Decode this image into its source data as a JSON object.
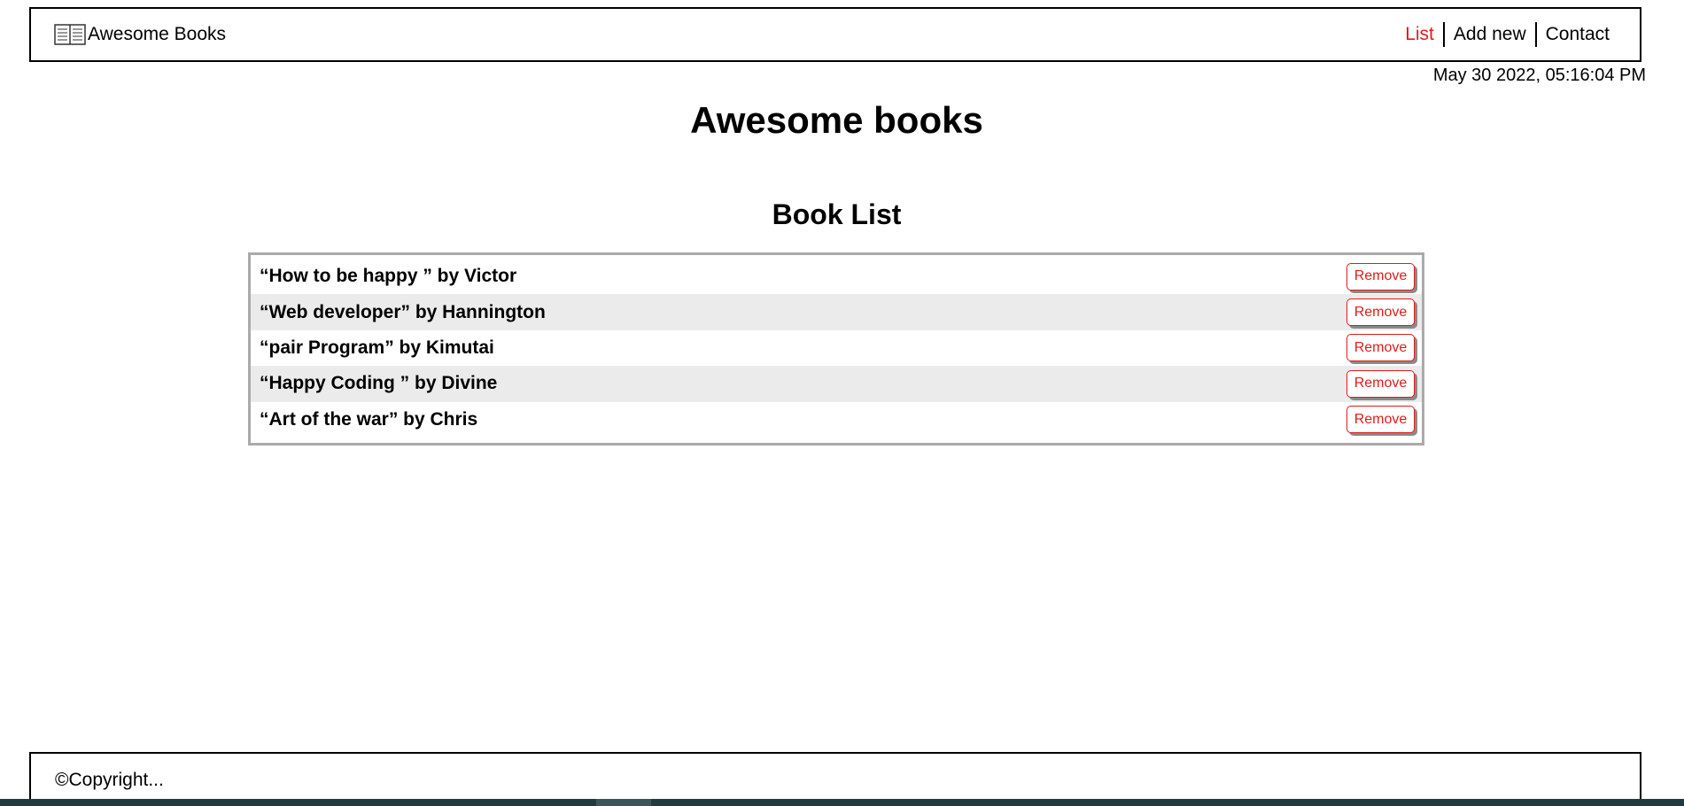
{
  "header": {
    "brand_icon": "book-icon",
    "brand_title": "Awesome Books",
    "nav": [
      {
        "label": "List",
        "active": true
      },
      {
        "label": "Add new",
        "active": false
      },
      {
        "label": "Contact",
        "active": false
      }
    ]
  },
  "datetime": "May 30 2022, 05:16:04 PM",
  "main_title": "Awesome books",
  "section_title": "Book List",
  "books": [
    {
      "text": "“How to be happy ” by Victor",
      "button": "Remove"
    },
    {
      "text": "“Web developer” by Hannington",
      "button": "Remove"
    },
    {
      "text": "“pair Program” by Kimutai",
      "button": "Remove"
    },
    {
      "text": "“Happy Coding ” by Divine",
      "button": "Remove"
    },
    {
      "text": "“Art of the war” by Chris",
      "button": "Remove"
    }
  ],
  "footer": {
    "copyright": "©Copyright..."
  },
  "colors": {
    "accent": "#e01b1b",
    "row_alt": "#ebebeb",
    "list_border": "#aaaaaa"
  }
}
